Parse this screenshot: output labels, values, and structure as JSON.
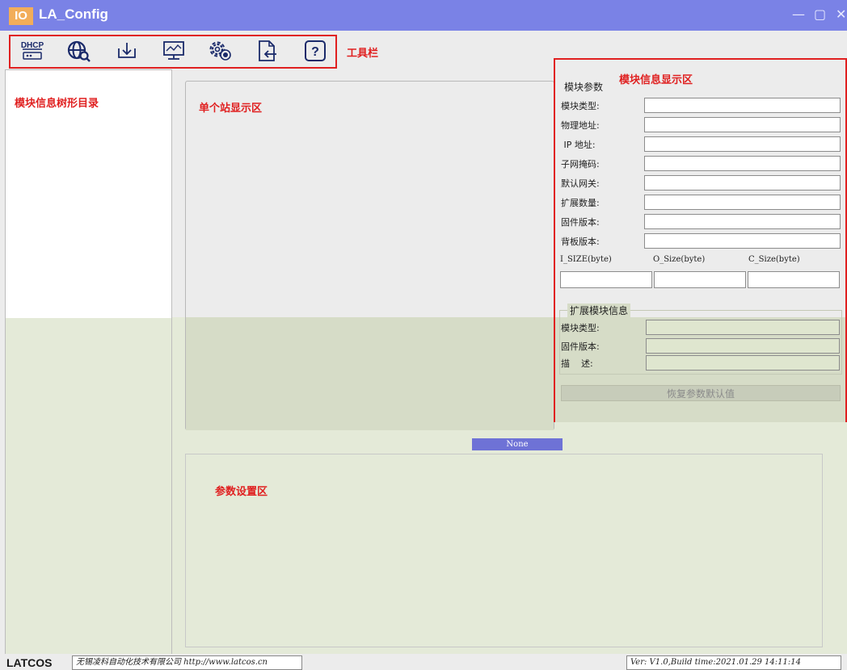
{
  "window": {
    "logo_text": "IO",
    "title": "LA_Config",
    "minimize_glyph": "—",
    "maximize_glyph": "▢",
    "close_glyph": "✕"
  },
  "toolbar": {
    "label": "工具栏",
    "icons": [
      "dhcp-icon",
      "network-search-icon",
      "download-icon",
      "monitor-icon",
      "settings-icon",
      "import-file-icon",
      "help-icon"
    ],
    "dhcp_text": "DHCP",
    "help_text": "?"
  },
  "tree": {
    "label": "模块信息树形目录"
  },
  "station": {
    "label": "单个站显示区"
  },
  "status": {
    "none_text": "None"
  },
  "params": {
    "label": "参数设置区"
  },
  "module_info": {
    "label": "模块信息显示区",
    "group_title": "模块参数",
    "fields": [
      {
        "label": "模块类型:",
        "value": ""
      },
      {
        "label": "物理地址:",
        "value": ""
      },
      {
        "label": " IP 地址:",
        "value": ""
      },
      {
        "label": "子网掩码:",
        "value": ""
      },
      {
        "label": "默认网关:",
        "value": ""
      },
      {
        "label": "扩展数量:",
        "value": ""
      },
      {
        "label": "固件版本:",
        "value": ""
      },
      {
        "label": "背板版本:",
        "value": ""
      }
    ],
    "sizes": [
      {
        "label": "I_SIZE(byte)",
        "value": ""
      },
      {
        "label": "O_Size(byte)",
        "value": ""
      },
      {
        "label": "C_Size(byte)",
        "value": ""
      }
    ],
    "extension": {
      "group_title": "扩展模块信息",
      "fields": [
        {
          "label": "模块类型:",
          "value": ""
        },
        {
          "label": "固件版本:",
          "value": ""
        },
        {
          "label": "描    述:",
          "value": ""
        }
      ]
    },
    "restore_button": "恢复参数默认值"
  },
  "footer": {
    "logo": "LATCOS",
    "company": "无锡凌科自动化技术有限公司 http://www.latcos.cn",
    "version": "Ver: V1.0,Build time:2021.01.29 14:11:14"
  },
  "colors": {
    "titlebar": "#7a82e6",
    "accent_red": "#e02020",
    "status_bar": "#6e72d6",
    "green_panel": "#e4ead8"
  }
}
